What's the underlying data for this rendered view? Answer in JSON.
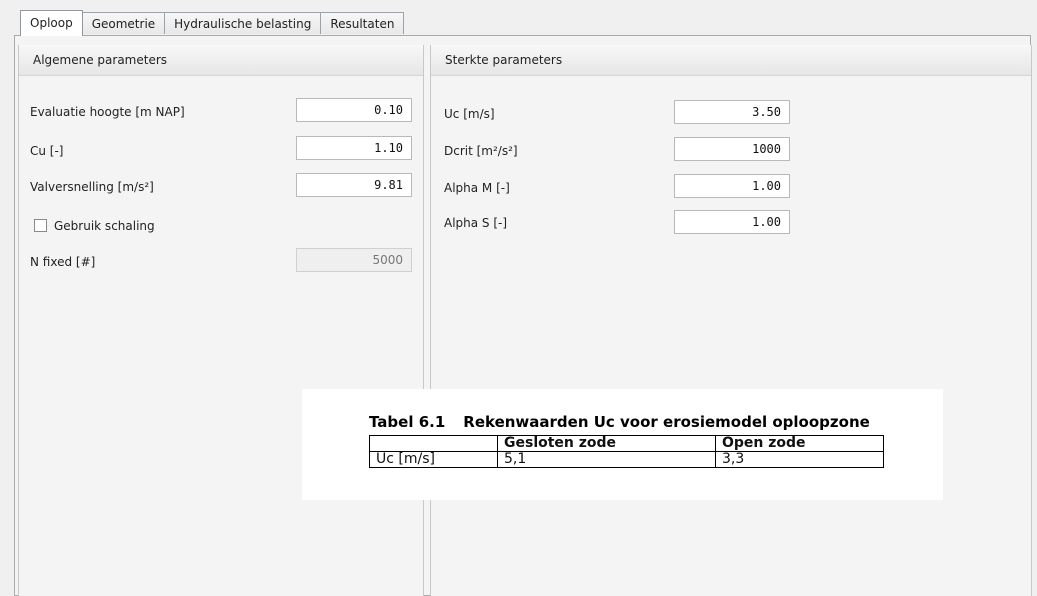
{
  "tabs": [
    {
      "label": "Oploop",
      "active": true
    },
    {
      "label": "Geometrie",
      "active": false
    },
    {
      "label": "Hydraulische belasting",
      "active": false
    },
    {
      "label": "Resultaten",
      "active": false
    }
  ],
  "left_group": {
    "title": "Algemene parameters",
    "fields": [
      {
        "label": "Evaluatie hoogte [m NAP]",
        "value": "0.10"
      },
      {
        "label": "Cu [-]",
        "value": "1.10"
      },
      {
        "label": "Valversnelling [m/s²]",
        "value": "9.81"
      }
    ],
    "checkbox": {
      "label": "Gebruik schaling",
      "checked": false
    },
    "n_fixed": {
      "label": "N fixed [#]",
      "value": "5000",
      "enabled": false
    }
  },
  "right_group": {
    "title": "Sterkte parameters",
    "fields": [
      {
        "label": "Uc [m/s]",
        "value": "3.50"
      },
      {
        "label": "Dcrit [m²/s²]",
        "value": "1000"
      },
      {
        "label": "Alpha M [-]",
        "value": "1.00"
      },
      {
        "label": "Alpha S [-]",
        "value": "1.00"
      }
    ]
  },
  "overlay_table": {
    "number": "Tabel 6.1",
    "title": "Rekenwaarden Uc voor erosiemodel oploopzone",
    "headers": [
      "",
      "Gesloten zode",
      "Open zode"
    ],
    "row_label": "Uc [m/s]",
    "row_values": [
      "5,1",
      "3,3"
    ]
  }
}
